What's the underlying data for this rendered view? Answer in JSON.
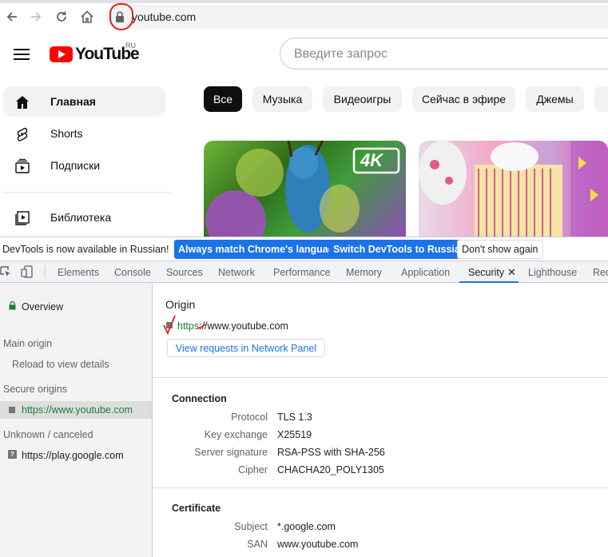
{
  "browser": {
    "url": "youtube.com",
    "back_icon": "arrow-left-icon",
    "forward_icon": "arrow-right-icon",
    "reload_icon": "reload-icon",
    "home_icon": "home-icon",
    "lock_icon": "lock-icon"
  },
  "youtube": {
    "logo_text": "YouTube",
    "region": "RU",
    "search_placeholder": "Введите запрос",
    "sidebar": [
      {
        "label": "Главная",
        "icon": "home-icon",
        "active": true
      },
      {
        "label": "Shorts",
        "icon": "shorts-icon",
        "active": false
      },
      {
        "label": "Подписки",
        "icon": "subscriptions-icon",
        "active": false
      },
      {
        "label": "Библиотека",
        "icon": "library-icon",
        "active": false
      }
    ],
    "chips": [
      "Все",
      "Музыка",
      "Видеоигры",
      "Сейчас в эфире",
      "Джемы"
    ],
    "thumb_badge": "4K"
  },
  "infobar": {
    "message": "DevTools is now available in Russian!",
    "btn_match": "Always match Chrome's language",
    "btn_switch": "Switch DevTools to Russian",
    "btn_dismiss": "Don't show again"
  },
  "devtools": {
    "tabs": [
      "Elements",
      "Console",
      "Sources",
      "Network",
      "Performance",
      "Memory",
      "Application",
      "Security",
      "Lighthouse",
      "Rec"
    ],
    "active_tab": "Security",
    "close_symbol": "✕"
  },
  "security": {
    "overview": "Overview",
    "main_origin_heading": "Main origin",
    "reload_text": "Reload to view details",
    "secure_heading": "Secure origins",
    "secure_origin": "https://www.youtube.com",
    "unknown_heading": "Unknown / canceled",
    "unknown_origin": "https://play.google.com",
    "origin_title": "Origin",
    "origin_scheme": "https",
    "origin_rest": "://www.youtube.com",
    "view_requests": "View requests in Network Panel",
    "connection": {
      "title": "Connection",
      "rows": [
        {
          "label": "Protocol",
          "value": "TLS 1.3"
        },
        {
          "label": "Key exchange",
          "value": "X25519"
        },
        {
          "label": "Server signature",
          "value": "RSA-PSS with SHA-256"
        },
        {
          "label": "Cipher",
          "value": "CHACHA20_POLY1305"
        }
      ]
    },
    "certificate": {
      "title": "Certificate",
      "rows": [
        {
          "label": "Subject",
          "value": "*.google.com"
        },
        {
          "label": "SAN",
          "value": "www.youtube.com"
        }
      ]
    }
  },
  "colors": {
    "accent": "#1a73e8",
    "secure_green": "#188038",
    "yt_red": "#ff0000",
    "annotation_red": "#e0201f"
  }
}
